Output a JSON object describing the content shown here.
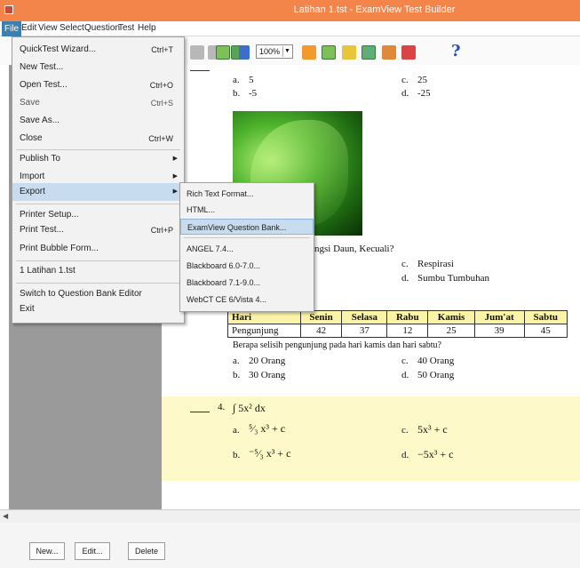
{
  "window": {
    "title": "Latihan 1.tst - ExamView Test Builder"
  },
  "menubar": {
    "items": [
      "File",
      "Edit",
      "View",
      "Select",
      "Question",
      "Test",
      "Help"
    ]
  },
  "toolbar": {
    "zoom": "100%"
  },
  "file_menu": {
    "items": [
      {
        "label": "QuickTest Wizard...",
        "shortcut": "Ctrl+T"
      },
      {
        "label": "New Test...",
        "shortcut": ""
      },
      {
        "label": "Open Test...",
        "shortcut": "Ctrl+O"
      },
      {
        "label": "Save",
        "shortcut": "Ctrl+S"
      },
      {
        "label": "Save As...",
        "shortcut": ""
      },
      {
        "label": "Close",
        "shortcut": "Ctrl+W"
      },
      {
        "label": "Publish To",
        "shortcut": ""
      },
      {
        "label": "Import",
        "shortcut": ""
      },
      {
        "label": "Export",
        "shortcut": ""
      },
      {
        "label": "Printer Setup...",
        "shortcut": ""
      },
      {
        "label": "Print Test...",
        "shortcut": "Ctrl+P"
      },
      {
        "label": "Print Bubble Form...",
        "shortcut": ""
      },
      {
        "label": "1 Latihan 1.tst",
        "shortcut": ""
      },
      {
        "label": "Switch to Question Bank Editor",
        "shortcut": ""
      },
      {
        "label": "Exit",
        "shortcut": ""
      }
    ]
  },
  "export_menu": {
    "items": [
      "Rich Text Format...",
      "HTML...",
      "ExamView Question Bank...",
      "ANGEL 7.4...",
      "Blackboard 6.0-7.0...",
      "Blackboard 7.1-9.0...",
      "WebCT CE 6/Vista 4..."
    ]
  },
  "document": {
    "q1": {
      "a": "a.",
      "a_val": "5",
      "b": "b.",
      "b_val": "-5",
      "c": "c.",
      "c_val": "25",
      "d": "d.",
      "d_val": "-25"
    },
    "q2": {
      "stem_tail": "ngsi Daun, Kecuali?",
      "c": "c.",
      "c_val": "Respirasi",
      "d": "d.",
      "d_val": "Sumbu Tumbuhan"
    },
    "table": {
      "headers": [
        "Hari",
        "Senin",
        "Selasa",
        "Rabu",
        "Kamis",
        "Jum'at",
        "Sabtu"
      ],
      "row": [
        "Pengunjung",
        "42",
        "37",
        "12",
        "25",
        "39",
        "45"
      ]
    },
    "q3": {
      "stem": "Berapa selisih pengunjung pada hari kamis dan hari sabtu?",
      "a": "a.",
      "a_val": "20 Orang",
      "b": "b.",
      "b_val": "30 Orang",
      "c": "c.",
      "c_val": "40 Orang",
      "d": "d.",
      "d_val": "50 Orang"
    },
    "q4": {
      "number": "4.",
      "stem": "∫ 5x² dx",
      "a": "a.",
      "a_val": "⁵⁄₃ x³ + c",
      "b": "b.",
      "b_val": "⁻⁵⁄₃ x³ + c",
      "c": "c.",
      "c_val": "5x³ + c",
      "d": "d.",
      "d_val": "−5x³ + c"
    }
  },
  "bottom": {
    "buttons": [
      "New...",
      "Edit...",
      "Delete"
    ]
  },
  "colors": {
    "titlebar": "#f4854a",
    "highlight": "#fdf9c9",
    "table_header": "#fbf3a8",
    "menu_highlight": "#c7dcef"
  }
}
